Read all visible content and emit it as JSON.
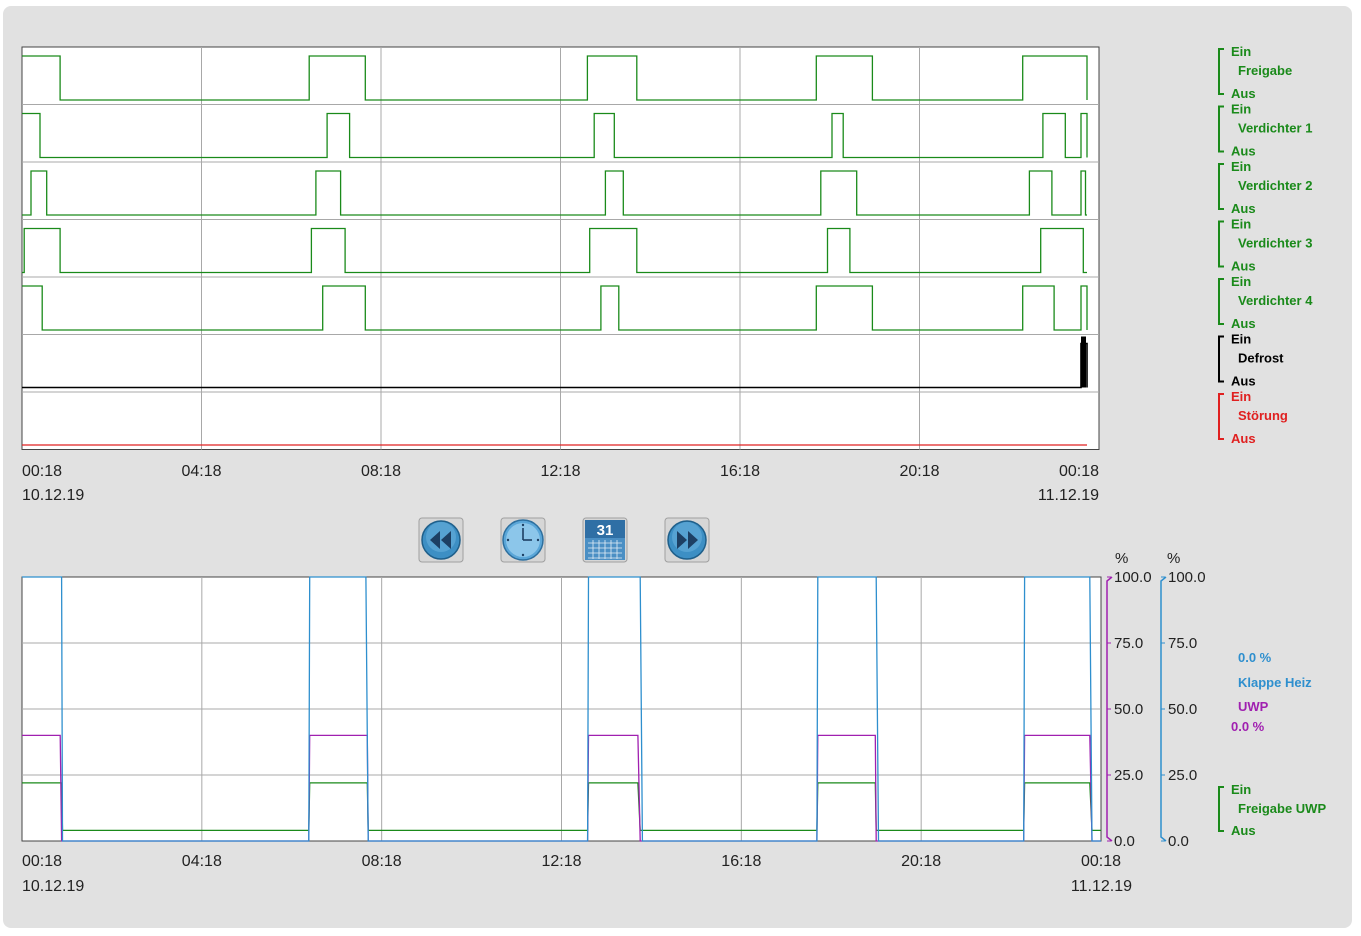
{
  "chart_data": [
    {
      "type": "line",
      "subtype": "digital-state-timeline",
      "x_unit": "hours since 00:18 10.12.19",
      "x_range": [
        0,
        24
      ],
      "x_ticks": [
        "00:18",
        "04:18",
        "08:18",
        "12:18",
        "16:18",
        "20:18",
        "00:18"
      ],
      "x_date_start": "10.12.19",
      "x_date_end": "11.12.19",
      "series": [
        {
          "name": "Freigabe",
          "on_label": "Ein",
          "off_label": "Aus",
          "color": "#1a8a1a",
          "intervals": [
            [
              0,
              0.85
            ],
            [
              6.4,
              7.65
            ],
            [
              12.6,
              13.7
            ],
            [
              17.7,
              18.95
            ],
            [
              22.3,
              23.75
            ]
          ]
        },
        {
          "name": "Verdichter 1",
          "on_label": "Ein",
          "off_label": "Aus",
          "color": "#1a8a1a",
          "intervals": [
            [
              0,
              0.4
            ],
            [
              6.8,
              7.3
            ],
            [
              12.75,
              13.2
            ],
            [
              18.05,
              18.3
            ],
            [
              22.75,
              23.25
            ],
            [
              23.6,
              23.75
            ]
          ]
        },
        {
          "name": "Verdichter 2",
          "on_label": "Ein",
          "off_label": "Aus",
          "color": "#1a8a1a",
          "intervals": [
            [
              0.2,
              0.55
            ],
            [
              6.55,
              7.1
            ],
            [
              13.0,
              13.4
            ],
            [
              17.8,
              18.6
            ],
            [
              22.45,
              22.95
            ],
            [
              23.6,
              23.7
            ]
          ]
        },
        {
          "name": "Verdichter 3",
          "on_label": "Ein",
          "off_label": "Aus",
          "color": "#1a8a1a",
          "intervals": [
            [
              0.05,
              0.85
            ],
            [
              6.45,
              7.2
            ],
            [
              12.65,
              13.7
            ],
            [
              17.95,
              18.45
            ],
            [
              22.7,
              23.65
            ]
          ]
        },
        {
          "name": "Verdichter 4",
          "on_label": "Ein",
          "off_label": "Aus",
          "color": "#1a8a1a",
          "intervals": [
            [
              0,
              0.45
            ],
            [
              6.7,
              7.65
            ],
            [
              12.9,
              13.3
            ],
            [
              17.7,
              18.95
            ],
            [
              22.3,
              23.0
            ],
            [
              23.6,
              23.75
            ]
          ]
        },
        {
          "name": "Defrost",
          "on_label": "Ein",
          "off_label": "Aus",
          "color": "#000000",
          "intervals": [
            [
              23.6,
              23.75
            ]
          ]
        },
        {
          "name": "Störung",
          "on_label": "Ein",
          "off_label": "Aus",
          "color": "#e02020",
          "intervals": []
        }
      ]
    },
    {
      "type": "line",
      "x_unit": "hours since 00:18 10.12.19",
      "x_range": [
        0,
        24
      ],
      "x_ticks": [
        "00:18",
        "04:18",
        "08:18",
        "12:18",
        "16:18",
        "20:18",
        "00:18"
      ],
      "x_date_start": "10.12.19",
      "x_date_end": "11.12.19",
      "y_unit": "%",
      "ylim": [
        0,
        100
      ],
      "y_ticks": [
        "100.0",
        "75.0",
        "50.0",
        "25.0",
        "0.0"
      ],
      "series": [
        {
          "name": "Klappe Heiz",
          "value_label": "0.0 %",
          "color": "#2e8fce",
          "x": [
            0,
            0.88,
            0.9,
            6.38,
            6.4,
            7.65,
            7.7,
            12.58,
            12.6,
            13.75,
            13.8,
            17.68,
            17.7,
            19.0,
            19.05,
            22.28,
            22.3,
            23.75,
            23.8,
            24
          ],
          "y": [
            100,
            100,
            0,
            0,
            100,
            100,
            0,
            0,
            100,
            100,
            0,
            0,
            100,
            100,
            0,
            0,
            100,
            100,
            0,
            0
          ]
        },
        {
          "name": "UWP",
          "value_label": "0.0 %",
          "color": "#a020b0",
          "x": [
            0,
            0.85,
            0.88,
            6.38,
            6.4,
            7.68,
            7.7,
            12.58,
            12.6,
            13.7,
            13.75,
            17.68,
            17.7,
            18.98,
            19.0,
            22.28,
            22.3,
            23.75,
            23.8,
            24
          ],
          "y": [
            40,
            40,
            0,
            0,
            40,
            40,
            0,
            0,
            40,
            40,
            0,
            0,
            40,
            40,
            0,
            0,
            40,
            40,
            0,
            0
          ]
        },
        {
          "name": "Freigabe UWP",
          "on_label": "Ein",
          "off_label": "Aus",
          "color": "#1a8a1a",
          "x": [
            0,
            0.88,
            0.9,
            6.38,
            6.4,
            7.68,
            7.7,
            12.58,
            12.6,
            13.7,
            13.75,
            17.68,
            17.7,
            18.98,
            19.0,
            22.28,
            22.3,
            23.75,
            23.8,
            24
          ],
          "y": [
            22,
            22,
            4,
            4,
            22,
            22,
            4,
            4,
            22,
            22,
            4,
            4,
            22,
            22,
            4,
            4,
            22,
            22,
            4,
            4
          ]
        }
      ]
    }
  ],
  "icons": {
    "rewind": "rewind-icon",
    "clock": "clock-icon",
    "calendar": "calendar-icon",
    "calendar_day": "31",
    "forward": "fast-forward-icon"
  },
  "colors": {
    "green": "#1a8a1a",
    "black": "#000000",
    "red": "#e02020",
    "blue": "#2e8fce",
    "purple": "#a020b0",
    "grid": "#a8a8a8",
    "panel": "#e1e1e1"
  }
}
